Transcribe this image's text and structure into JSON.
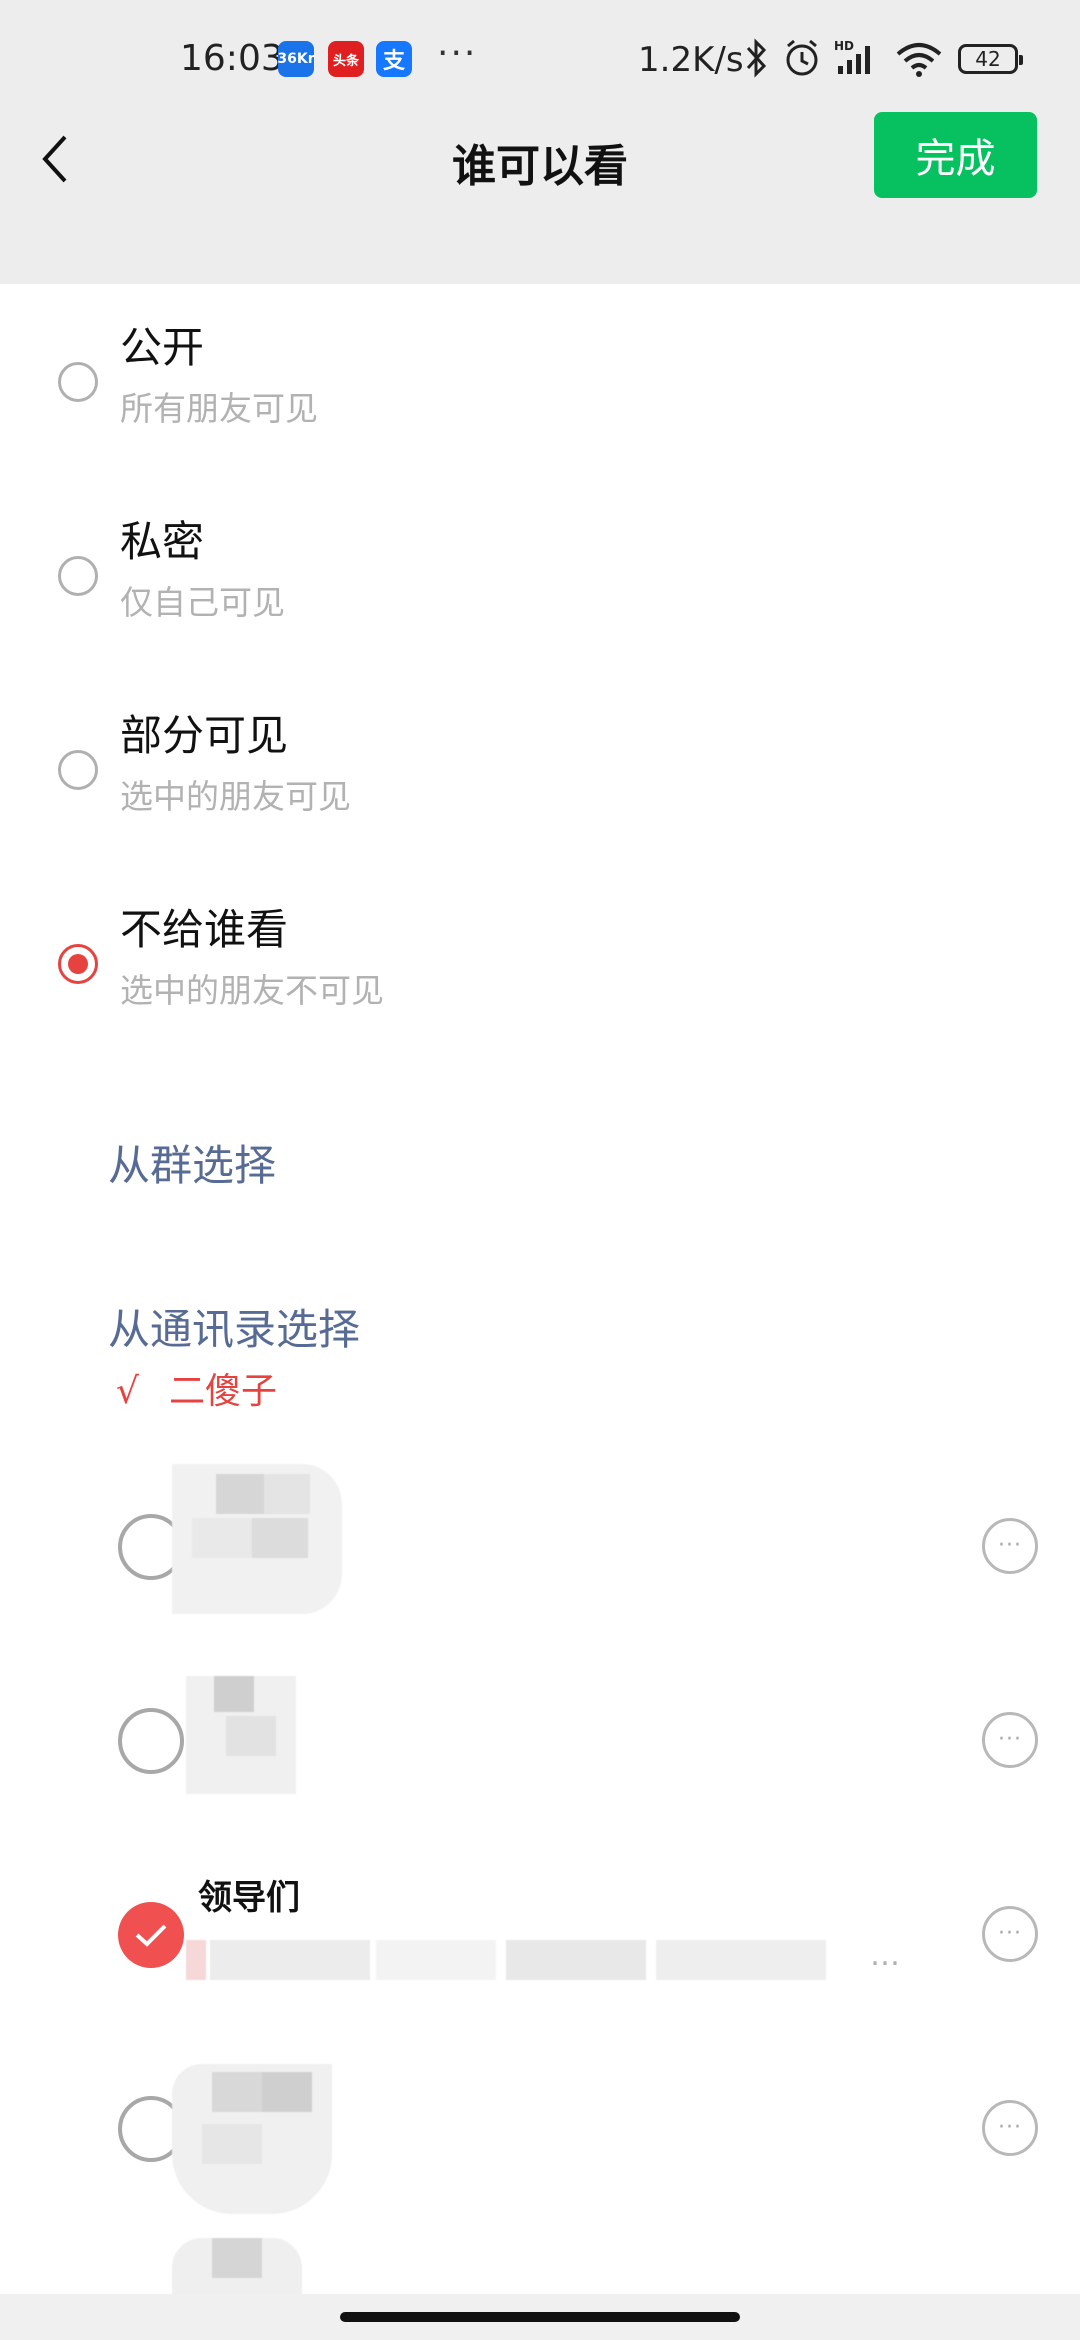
{
  "status_bar": {
    "time": "16:03",
    "apps": [
      {
        "name": "36kr-icon",
        "label": "36Kr",
        "color": "#1a73e8"
      },
      {
        "name": "toutiao-icon",
        "label": "头条",
        "color": "#e02020"
      },
      {
        "name": "alipay-icon",
        "label": "支",
        "color": "#1677ff"
      }
    ],
    "more": "···",
    "network_speed": "1.2K/s",
    "battery": "42"
  },
  "nav": {
    "title": "谁可以看",
    "done_label": "完成"
  },
  "options": [
    {
      "title": "公开",
      "subtitle": "所有朋友可见",
      "selected": false
    },
    {
      "title": "私密",
      "subtitle": "仅自己可见",
      "selected": false
    },
    {
      "title": "部分可见",
      "subtitle": "选中的朋友可见",
      "selected": false
    },
    {
      "title": "不给谁看",
      "subtitle": "选中的朋友不可见",
      "selected": true
    }
  ],
  "links": {
    "from_group": "从群选择",
    "from_contacts": "从通讯录选择"
  },
  "selected_contacts": {
    "check": "√",
    "names": "二傻子"
  },
  "groups": [
    {
      "name": "",
      "selected": false
    },
    {
      "name": "",
      "selected": false
    },
    {
      "name": "领导们",
      "subtitle": "…",
      "selected": true
    },
    {
      "name": "",
      "selected": false
    }
  ],
  "colors": {
    "accent_green": "#07c160",
    "accent_red": "#e64340",
    "link_blue": "#576b95"
  }
}
